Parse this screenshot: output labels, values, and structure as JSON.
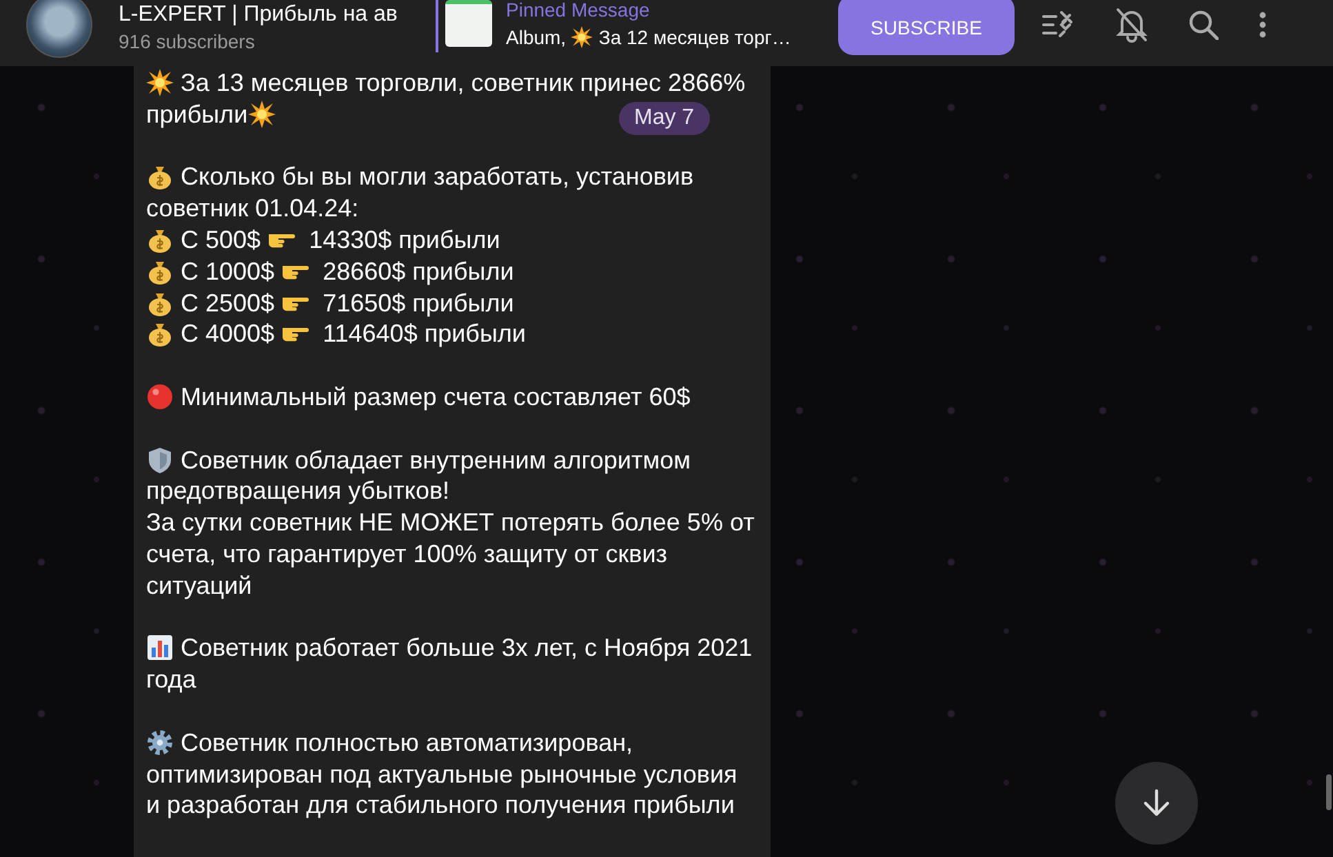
{
  "header": {
    "channel_name": "L-EXPERT | Прибыль на ав",
    "subscribers": "916 subscribers",
    "pinned": {
      "label": "Pinned Message",
      "segments": [
        {
          "kind": "text",
          "text": "Album, "
        },
        {
          "kind": "explosion"
        },
        {
          "kind": "text",
          "text": " За 12 месяцев торг…"
        }
      ]
    },
    "subscribe_button": "SUBSCRIBE"
  },
  "date_badge": "May 7",
  "message": {
    "paragraphs": [
      [
        [
          {
            "kind": "explosion"
          },
          {
            "kind": "text",
            "text": " За 13 месяцев торговли, советник принес 2866%"
          }
        ],
        [
          {
            "kind": "text",
            "text": "прибыли"
          },
          {
            "kind": "explosion"
          }
        ]
      ],
      [
        [
          {
            "kind": "moneybag"
          },
          {
            "kind": "text",
            "text": " Сколько бы вы могли заработать, установив"
          }
        ],
        [
          {
            "kind": "text",
            "text": "советник 01.04.24:"
          }
        ],
        [
          {
            "kind": "moneybag"
          },
          {
            "kind": "text",
            "text": " С 500$ "
          },
          {
            "kind": "hand"
          },
          {
            "kind": "text",
            "text": "  14330$ прибыли"
          }
        ],
        [
          {
            "kind": "moneybag"
          },
          {
            "kind": "text",
            "text": " С 1000$ "
          },
          {
            "kind": "hand"
          },
          {
            "kind": "text",
            "text": "  28660$ прибыли"
          }
        ],
        [
          {
            "kind": "moneybag"
          },
          {
            "kind": "text",
            "text": " С 2500$ "
          },
          {
            "kind": "hand"
          },
          {
            "kind": "text",
            "text": "  71650$ прибыли"
          }
        ],
        [
          {
            "kind": "moneybag"
          },
          {
            "kind": "text",
            "text": " С 4000$ "
          },
          {
            "kind": "hand"
          },
          {
            "kind": "text",
            "text": "  114640$ прибыли\n"
          }
        ]
      ],
      [
        [
          {
            "kind": "redcircle"
          },
          {
            "kind": "text",
            "text": " Минимальный размер счета составляет 60$"
          }
        ]
      ],
      [
        [
          {
            "kind": "shield"
          },
          {
            "kind": "text",
            "text": " Советник обладает внутренним алгоритмом"
          }
        ],
        [
          {
            "kind": "text",
            "text": "предотвращения убытков!"
          }
        ],
        [
          {
            "kind": "text",
            "text": "За сутки советник НЕ МОЖЕТ потерять более 5% от"
          }
        ],
        [
          {
            "kind": "text",
            "text": "счета, что гарантирует 100% защиту от сквиз"
          }
        ],
        [
          {
            "kind": "text",
            "text": "ситуаций"
          }
        ]
      ],
      [
        [
          {
            "kind": "chart"
          },
          {
            "kind": "text",
            "text": " Советник работает больше 3х лет, с Ноября 2021"
          }
        ],
        [
          {
            "kind": "text",
            "text": "года"
          }
        ]
      ],
      [
        [
          {
            "kind": "gear"
          },
          {
            "kind": "text",
            "text": " Советник полностью автоматизирован,"
          }
        ],
        [
          {
            "kind": "text",
            "text": "оптимизирован под актуальные рыночные условия"
          }
        ],
        [
          {
            "kind": "text",
            "text": "и разработан для стабильного получения прибыли"
          }
        ]
      ]
    ]
  }
}
